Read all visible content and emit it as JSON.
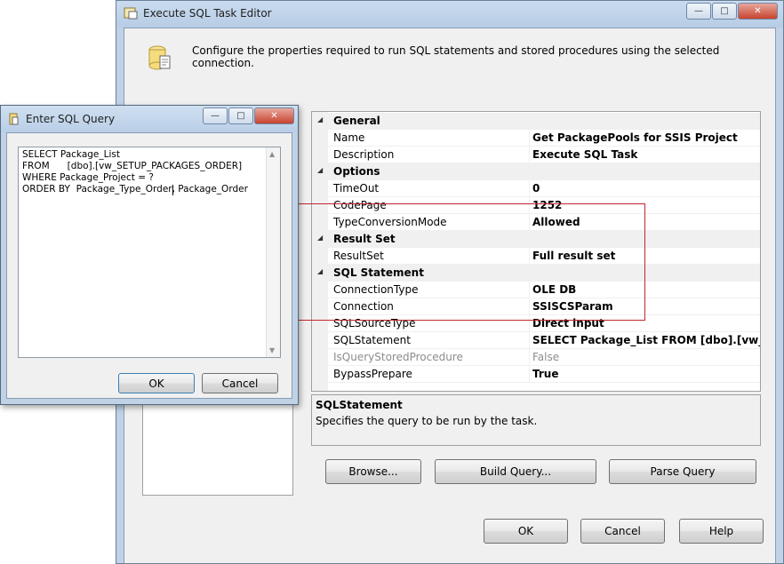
{
  "main_window": {
    "title": "Execute SQL Task Editor",
    "header_text": "Configure the properties required to run SQL statements and stored procedures using the selected connection.",
    "grid": {
      "rows": [
        {
          "kind": "category",
          "label": "General"
        },
        {
          "kind": "prop",
          "name": "Name",
          "value": "Get PackagePools for SSIS Project"
        },
        {
          "kind": "prop",
          "name": "Description",
          "value": "Execute SQL Task"
        },
        {
          "kind": "category",
          "label": "Options"
        },
        {
          "kind": "prop",
          "name": "TimeOut",
          "value": "0"
        },
        {
          "kind": "prop",
          "name": "CodePage",
          "value": "1252"
        },
        {
          "kind": "prop",
          "name": "TypeConversionMode",
          "value": "Allowed"
        },
        {
          "kind": "category",
          "label": "Result Set"
        },
        {
          "kind": "prop",
          "name": "ResultSet",
          "value": "Full result set"
        },
        {
          "kind": "category",
          "label": "SQL Statement"
        },
        {
          "kind": "prop",
          "name": "ConnectionType",
          "value": "OLE DB"
        },
        {
          "kind": "prop",
          "name": "Connection",
          "value": "SSISCSParam"
        },
        {
          "kind": "prop",
          "name": "SQLSourceType",
          "value": "Direct input"
        },
        {
          "kind": "prop",
          "name": "SQLStatement",
          "value": "SELECT Package_List FROM      [dbo].[vw_SETUP_PACKAGES_ORDER]"
        },
        {
          "kind": "prop",
          "name": "IsQueryStoredProcedure",
          "value": "False",
          "disabled": true
        },
        {
          "kind": "prop",
          "name": "BypassPrepare",
          "value": "True"
        }
      ]
    },
    "description": {
      "title": "SQLStatement",
      "text": "Specifies the query to be run by the task."
    },
    "buttons": {
      "browse": "Browse...",
      "build_query": "Build Query...",
      "parse_query": "Parse Query",
      "ok": "OK",
      "cancel": "Cancel",
      "help": "Help"
    },
    "highlight_color": "#c1272d"
  },
  "sql_dialog": {
    "title": "Enter SQL Query",
    "query_lines": [
      "SELECT Package_List",
      "FROM      [dbo].[vw_SETUP_PACKAGES_ORDER]",
      "WHERE Package_Project = ?",
      "ORDER BY  Package_Type_Order, Package_Order"
    ],
    "ok": "OK",
    "cancel": "Cancel"
  }
}
